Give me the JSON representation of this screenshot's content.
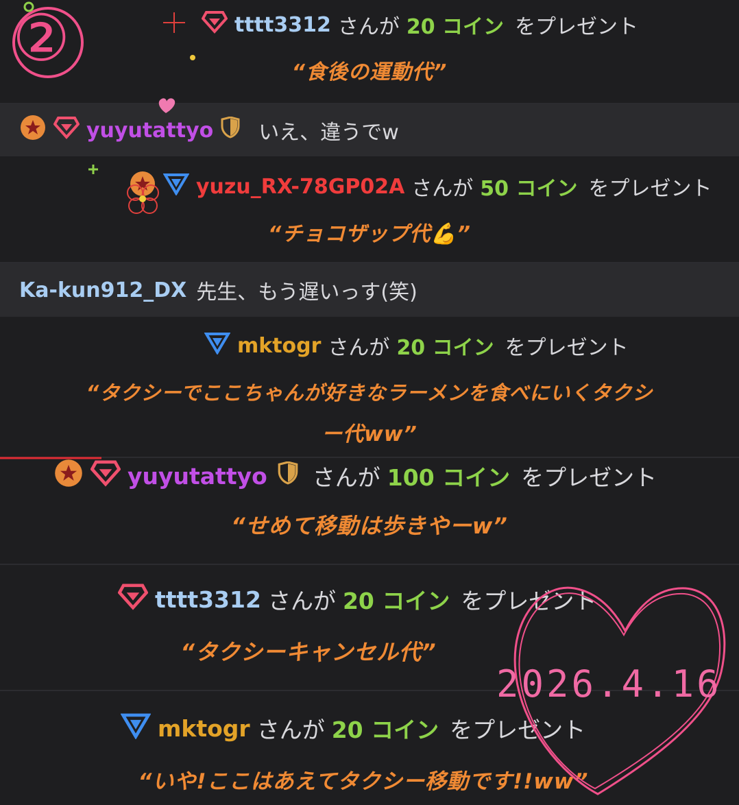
{
  "page_number": "②",
  "date_stamp": "2026.4.16",
  "colors": {
    "background": "#1e1e20",
    "chat_row": "#2b2b2e",
    "coin_green": "#8ed34a",
    "message_orange": "#f08a34",
    "heart_pink": "#f0508a"
  },
  "rows": {
    "gift1": {
      "user": "tttt3312",
      "sanga": "さんが",
      "amount": "20 コイン",
      "present": "をプレゼント",
      "message": "“食後の運動代”",
      "icon": "ruby-gem-icon"
    },
    "chat1": {
      "user": "yuyutattyo",
      "text": "いえ、違うでw",
      "icons": [
        "star-badge-icon",
        "ruby-gem-icon",
        "shield-icon"
      ]
    },
    "gift2": {
      "user": "yuzu_RX-78GP02A",
      "sanga": "さんが",
      "amount": "50 コイン",
      "present": "をプレゼント",
      "message": "“チョコザップ代💪”",
      "icons": [
        "star-badge-icon",
        "triangle-gem-icon"
      ]
    },
    "chat2": {
      "user": "Ka-kun912_DX",
      "text": "先生、もう遅いっす(笑)"
    },
    "gift3": {
      "user": "mktogr",
      "sanga": "さんが",
      "amount": "20 コイン",
      "present": "をプレゼント",
      "message_line1": "“タクシーでここちゃんが好きなラーメンを食べにいくタクシ",
      "message_line2": "ー代ww”",
      "icon": "triangle-gem-icon"
    },
    "gift4": {
      "user": "yuyutattyo",
      "sanga": "さんが",
      "amount": "100 コイン",
      "present": "をプレゼント",
      "message": "“せめて移動は歩きやーw”",
      "icons": [
        "star-badge-icon",
        "ruby-gem-icon",
        "shield-icon"
      ]
    },
    "gift5": {
      "user": "tttt3312",
      "sanga": "さんが",
      "amount": "20 コイン",
      "present": "をプレゼント",
      "message": "“タクシーキャンセル代”",
      "icon": "ruby-gem-icon"
    },
    "gift6": {
      "user": "mktogr",
      "sanga": "さんが",
      "amount": "20 コイン",
      "present": "をプレゼント",
      "message": "“いや!ここはあえてタクシー移動です!!ww”",
      "icon": "triangle-gem-icon"
    }
  }
}
